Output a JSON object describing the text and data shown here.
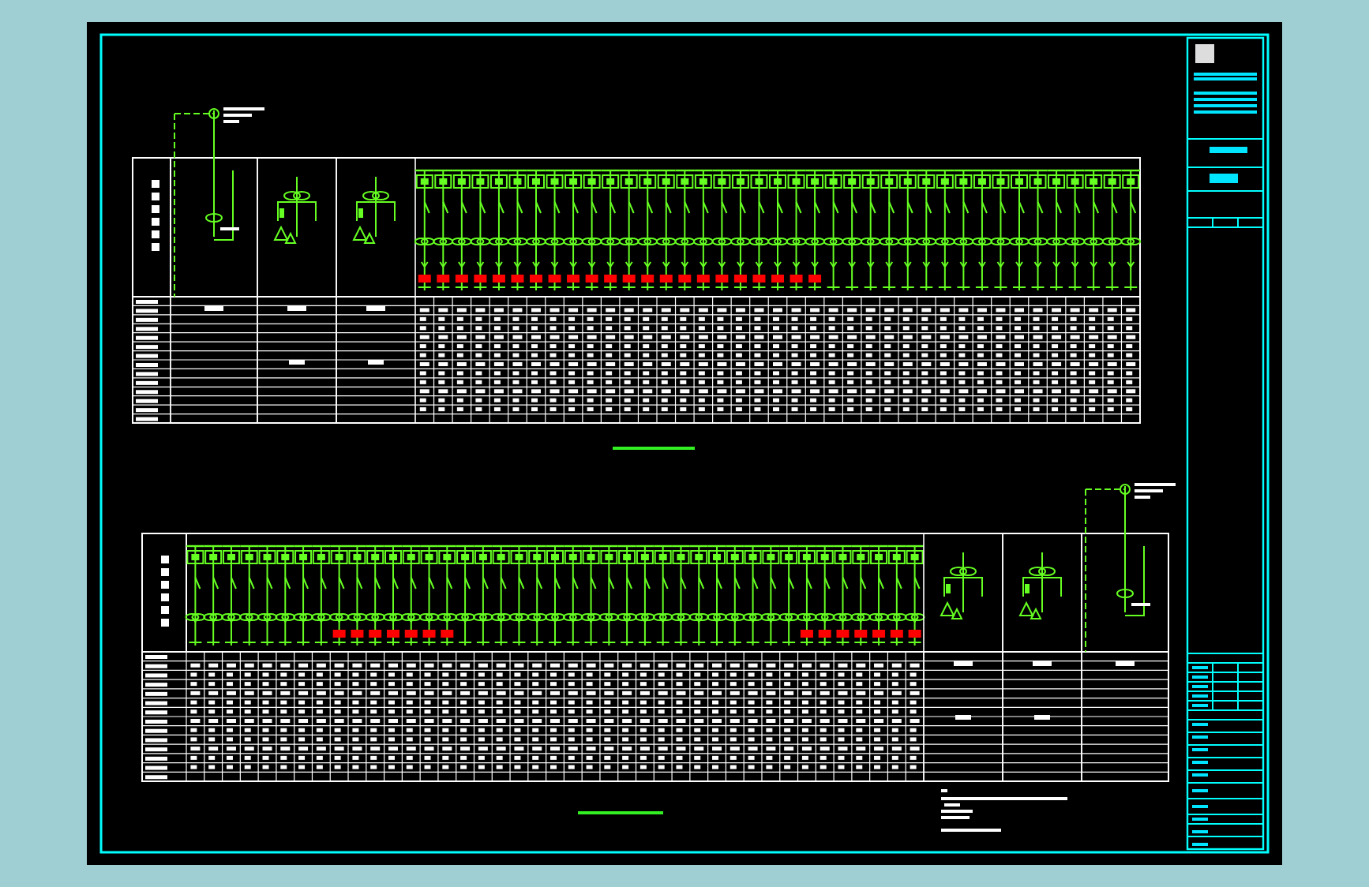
{
  "panels": [
    {
      "circuits": [
        {
          "kind": "incoming"
        },
        {
          "kind": "pt"
        },
        {
          "kind": "pt"
        },
        {
          "kind": "outgoing",
          "marked": true
        },
        {
          "kind": "outgoing",
          "marked": true
        },
        {
          "kind": "outgoing",
          "marked": true
        },
        {
          "kind": "outgoing",
          "marked": true
        },
        {
          "kind": "outgoing",
          "marked": true
        },
        {
          "kind": "outgoing",
          "marked": true
        },
        {
          "kind": "outgoing",
          "marked": true
        },
        {
          "kind": "outgoing",
          "marked": true
        },
        {
          "kind": "outgoing",
          "marked": true
        },
        {
          "kind": "outgoing",
          "marked": true
        },
        {
          "kind": "outgoing",
          "marked": true
        },
        {
          "kind": "outgoing",
          "marked": true
        },
        {
          "kind": "outgoing",
          "marked": true
        },
        {
          "kind": "outgoing",
          "marked": true
        },
        {
          "kind": "outgoing",
          "marked": true
        },
        {
          "kind": "outgoing",
          "marked": true
        },
        {
          "kind": "outgoing",
          "marked": true
        },
        {
          "kind": "outgoing",
          "marked": true
        },
        {
          "kind": "outgoing",
          "marked": true
        },
        {
          "kind": "outgoing",
          "marked": true
        },
        {
          "kind": "outgoing",
          "marked": true
        },
        {
          "kind": "outgoing",
          "marked": true
        },
        {
          "kind": "outgoing",
          "marked": false
        },
        {
          "kind": "outgoing",
          "marked": false
        },
        {
          "kind": "outgoing",
          "marked": false
        },
        {
          "kind": "outgoing",
          "marked": false
        },
        {
          "kind": "outgoing",
          "marked": false
        },
        {
          "kind": "outgoing",
          "marked": false
        },
        {
          "kind": "outgoing",
          "marked": false
        },
        {
          "kind": "outgoing",
          "marked": false
        },
        {
          "kind": "outgoing",
          "marked": false
        },
        {
          "kind": "outgoing",
          "marked": false
        },
        {
          "kind": "outgoing",
          "marked": false
        },
        {
          "kind": "outgoing",
          "marked": false
        },
        {
          "kind": "outgoing",
          "marked": false
        },
        {
          "kind": "outgoing",
          "marked": false
        },
        {
          "kind": "outgoing",
          "marked": false
        },
        {
          "kind": "outgoing",
          "marked": false
        },
        {
          "kind": "outgoing",
          "marked": false
        }
      ]
    },
    {
      "circuits": [
        {
          "kind": "outgoing",
          "marked": false
        },
        {
          "kind": "outgoing",
          "marked": false
        },
        {
          "kind": "outgoing",
          "marked": false
        },
        {
          "kind": "outgoing",
          "marked": false
        },
        {
          "kind": "outgoing",
          "marked": false
        },
        {
          "kind": "outgoing",
          "marked": false
        },
        {
          "kind": "outgoing",
          "marked": false
        },
        {
          "kind": "outgoing",
          "marked": false
        },
        {
          "kind": "outgoing",
          "marked": true
        },
        {
          "kind": "outgoing",
          "marked": true
        },
        {
          "kind": "outgoing",
          "marked": true
        },
        {
          "kind": "outgoing",
          "marked": true
        },
        {
          "kind": "outgoing",
          "marked": true
        },
        {
          "kind": "outgoing",
          "marked": true
        },
        {
          "kind": "outgoing",
          "marked": true
        },
        {
          "kind": "outgoing",
          "marked": false
        },
        {
          "kind": "outgoing",
          "marked": false
        },
        {
          "kind": "outgoing",
          "marked": false
        },
        {
          "kind": "outgoing",
          "marked": false
        },
        {
          "kind": "outgoing",
          "marked": false
        },
        {
          "kind": "outgoing",
          "marked": false
        },
        {
          "kind": "outgoing",
          "marked": false
        },
        {
          "kind": "outgoing",
          "marked": false
        },
        {
          "kind": "outgoing",
          "marked": false
        },
        {
          "kind": "outgoing",
          "marked": false
        },
        {
          "kind": "outgoing",
          "marked": false
        },
        {
          "kind": "outgoing",
          "marked": false
        },
        {
          "kind": "outgoing",
          "marked": false
        },
        {
          "kind": "outgoing",
          "marked": false
        },
        {
          "kind": "outgoing",
          "marked": false
        },
        {
          "kind": "outgoing",
          "marked": false
        },
        {
          "kind": "outgoing",
          "marked": false
        },
        {
          "kind": "outgoing",
          "marked": false
        },
        {
          "kind": "outgoing",
          "marked": false
        },
        {
          "kind": "outgoing",
          "marked": true
        },
        {
          "kind": "outgoing",
          "marked": true
        },
        {
          "kind": "outgoing",
          "marked": true
        },
        {
          "kind": "outgoing",
          "marked": true
        },
        {
          "kind": "outgoing",
          "marked": true
        },
        {
          "kind": "outgoing",
          "marked": true
        },
        {
          "kind": "outgoing",
          "marked": true
        },
        {
          "kind": "pt"
        },
        {
          "kind": "pt"
        },
        {
          "kind": "incoming"
        }
      ]
    }
  ]
}
